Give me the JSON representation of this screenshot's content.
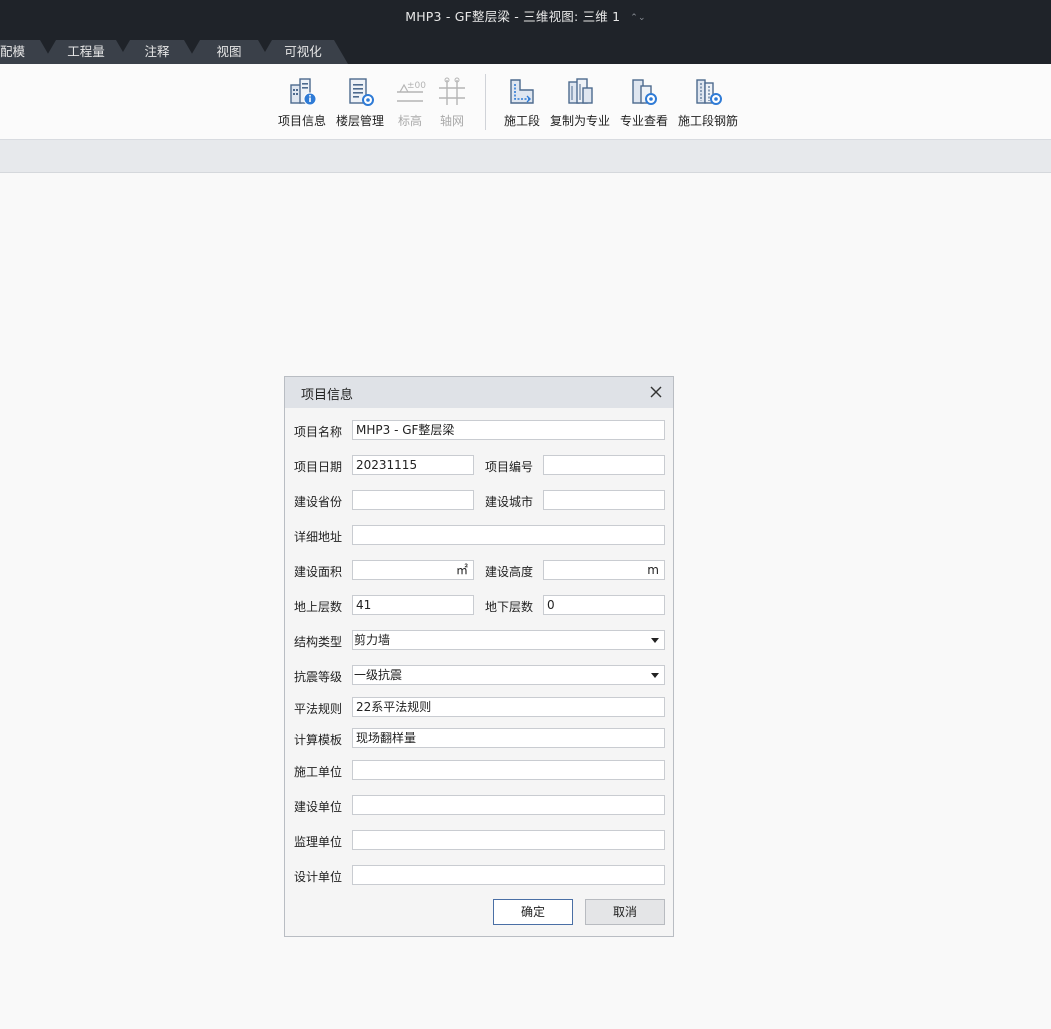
{
  "window": {
    "title": "MHP3 - GF整层梁 - 三维视图: 三维 1"
  },
  "ribbon_tabs": [
    "配模",
    "工程量",
    "注释",
    "视图",
    "可视化"
  ],
  "ribbon_buttons": {
    "project_info": "项目信息",
    "floor_manage": "楼层管理",
    "elevation": "标高",
    "grid": "轴网",
    "construction_segment": "施工段",
    "copy_to_discipline": "复制为专业",
    "discipline_view": "专业查看",
    "segment_rebar": "施工段钢筋"
  },
  "dialog": {
    "title": "项目信息",
    "labels": {
      "project_name": "项目名称",
      "project_date": "项目日期",
      "project_number": "项目编号",
      "province": "建设省份",
      "city": "建设城市",
      "address": "详细地址",
      "area": "建设面积",
      "height": "建设高度",
      "floors_above": "地上层数",
      "floors_below": "地下层数",
      "structure_type": "结构类型",
      "seismic_grade": "抗震等级",
      "rule": "平法规则",
      "template": "计算模板",
      "construction_unit": "施工单位",
      "owner_unit": "建设单位",
      "supervision_unit": "监理单位",
      "design_unit": "设计单位"
    },
    "values": {
      "project_name": "MHP3 - GF整层梁",
      "project_date": "20231115",
      "project_number": "",
      "province": "",
      "city": "",
      "address": "",
      "area": "",
      "area_unit": "㎡",
      "height": "",
      "height_unit": "m",
      "floors_above": "41",
      "floors_below": "0",
      "structure_type": "剪力墙",
      "seismic_grade": "一级抗震",
      "rule": "22系平法规则",
      "template": "现场翻样量",
      "construction_unit": "",
      "owner_unit": "",
      "supervision_unit": "",
      "design_unit": ""
    },
    "ok_label": "确定",
    "cancel_label": "取消"
  }
}
